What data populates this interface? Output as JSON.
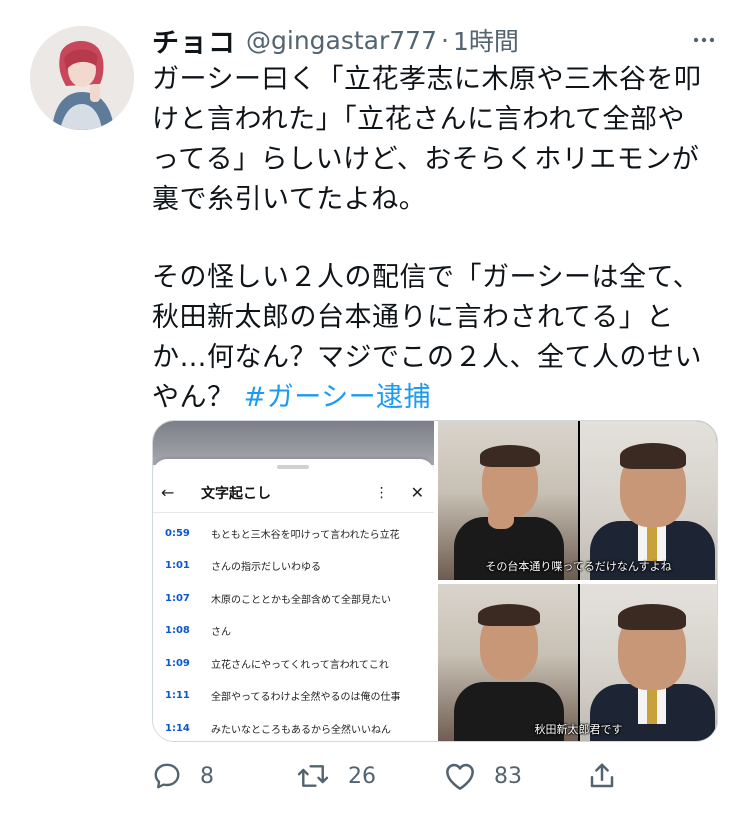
{
  "tweet": {
    "display_name": "チョコ",
    "handle": "@gingastar777",
    "separator": "·",
    "time": "1時間",
    "text_lines_1": [
      "ガーシー曰く「立花孝志に木原や三木谷を叩",
      "けと言われた」「立花さんに言われて全部や",
      "ってる」らしいけど、おそらくホリエモンが",
      "裏で糸引いてたよね。"
    ],
    "text_lines_2": [
      "その怪しい２人の配信で「ガーシーは全て、",
      "秋田新太郎の台本通りに言わされてる」と",
      "か…何なん？マジでこの２人、全て人のせい"
    ],
    "last_line_text": "やん？ ",
    "hashtag": "#ガーシー逮捕"
  },
  "transcript_panel": {
    "title": "文字起こし",
    "rows": [
      {
        "time": "0:59",
        "text": "もともと三木谷を叩けって言われたら立花"
      },
      {
        "time": "1:01",
        "text": "さんの指示だしいわゆる"
      },
      {
        "time": "1:07",
        "text": "木原のこととかも全部含めて全部見たい"
      },
      {
        "time": "1:08",
        "text": "さん"
      },
      {
        "time": "1:09",
        "text": "立花さんにやってくれって言われてこれ"
      },
      {
        "time": "1:11",
        "text": "全部やってるわけよ全然やるのは俺の仕事"
      },
      {
        "time": "1:14",
        "text": "みたいなところもあるから全然いいねん"
      }
    ]
  },
  "video_frames": {
    "top_caption": "その台本通り喋ってるだけなんすよね",
    "bottom_caption": "秋田新太郎君です"
  },
  "actions": {
    "reply_count": "8",
    "retweet_count": "26",
    "like_count": "83"
  },
  "colors": {
    "accent": "#1d9bf0",
    "muted": "#536471",
    "text": "#0f1419"
  },
  "icons": [
    "more-icon",
    "reply-icon",
    "retweet-icon",
    "like-icon",
    "share-icon",
    "back-arrow-icon",
    "close-icon"
  ]
}
